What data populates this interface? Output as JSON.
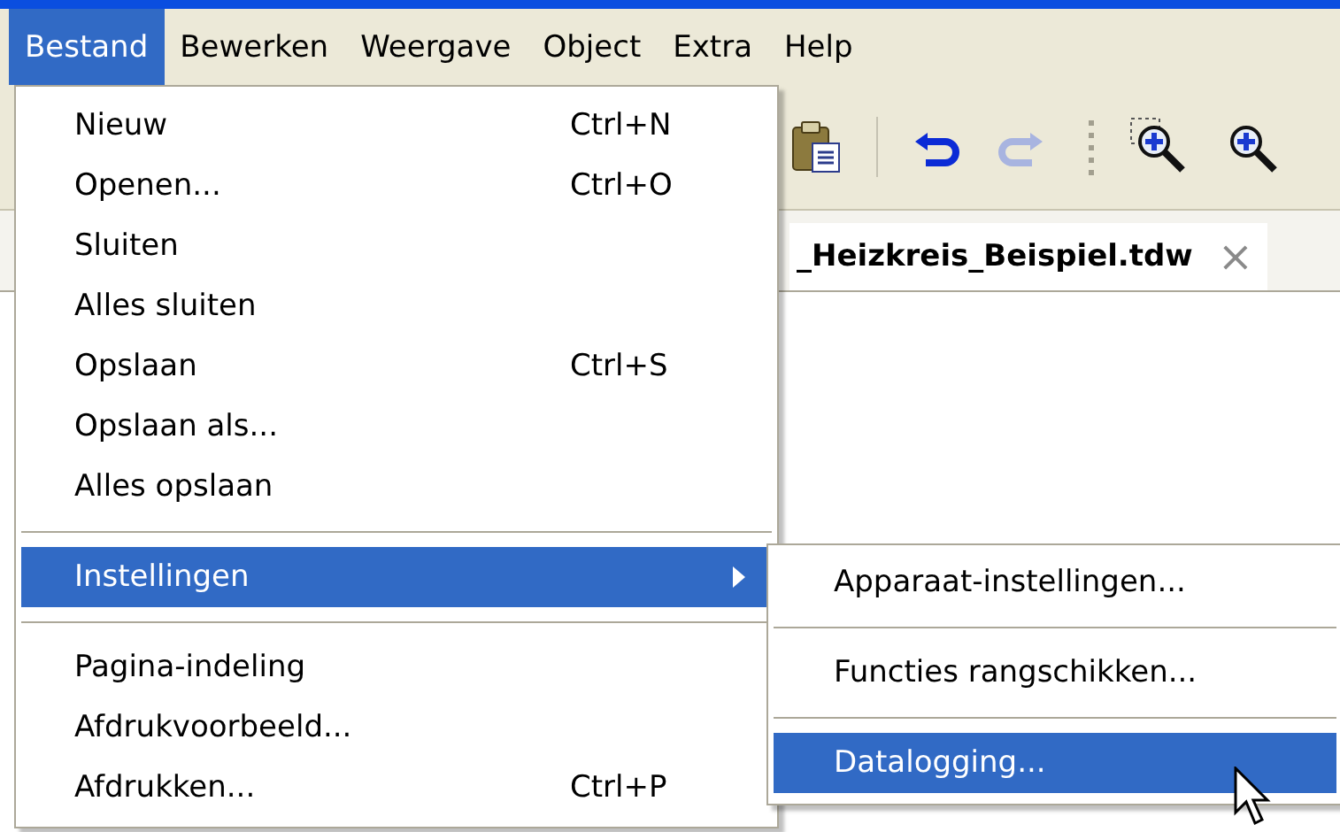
{
  "menubar": [
    {
      "label": "Bestand",
      "selected": true
    },
    {
      "label": "Bewerken",
      "selected": false
    },
    {
      "label": "Weergave",
      "selected": false
    },
    {
      "label": "Object",
      "selected": false
    },
    {
      "label": "Extra",
      "selected": false
    },
    {
      "label": "Help",
      "selected": false
    }
  ],
  "toolbar": {
    "buttons": [
      {
        "kind": "paste",
        "disabled": false
      },
      {
        "kind": "separator"
      },
      {
        "kind": "undo",
        "disabled": false
      },
      {
        "kind": "redo",
        "disabled": true
      },
      {
        "kind": "grip"
      },
      {
        "kind": "zoom_selection",
        "disabled": false
      },
      {
        "kind": "zoom_in",
        "disabled": false
      }
    ]
  },
  "document_tab": {
    "title": "_Heizkreis_Beispiel.tdw",
    "close": "×"
  },
  "file_menu": [
    {
      "kind": "item",
      "label": "Nieuw",
      "shortcut": "Ctrl+N",
      "selected": false,
      "submenu": false
    },
    {
      "kind": "item",
      "label": "Openen...",
      "shortcut": "Ctrl+O",
      "selected": false,
      "submenu": false
    },
    {
      "kind": "item",
      "label": "Sluiten",
      "selected": false,
      "submenu": false
    },
    {
      "kind": "item",
      "label": "Alles sluiten",
      "selected": false,
      "submenu": false
    },
    {
      "kind": "item",
      "label": "Opslaan",
      "shortcut": "Ctrl+S",
      "selected": false,
      "submenu": false
    },
    {
      "kind": "item",
      "label": "Opslaan als...",
      "selected": false,
      "submenu": false
    },
    {
      "kind": "item",
      "label": "Alles opslaan",
      "selected": false,
      "submenu": false
    },
    {
      "kind": "separator"
    },
    {
      "kind": "item",
      "label": "Instellingen",
      "selected": true,
      "submenu": true
    },
    {
      "kind": "separator"
    },
    {
      "kind": "item",
      "label": "Pagina-indeling",
      "selected": false,
      "submenu": false
    },
    {
      "kind": "item",
      "label": "Afdrukvoorbeeld...",
      "selected": false,
      "submenu": false
    },
    {
      "kind": "item",
      "label": "Afdrukken...",
      "shortcut": "Ctrl+P",
      "selected": false,
      "submenu": false
    }
  ],
  "settings_submenu": [
    {
      "kind": "item",
      "label": "Apparaat-instellingen...",
      "selected": false
    },
    {
      "kind": "separator"
    },
    {
      "kind": "item",
      "label": "Functies rangschikken...",
      "selected": false
    },
    {
      "kind": "separator"
    },
    {
      "kind": "item",
      "label": "Datalogging...",
      "selected": true
    }
  ]
}
